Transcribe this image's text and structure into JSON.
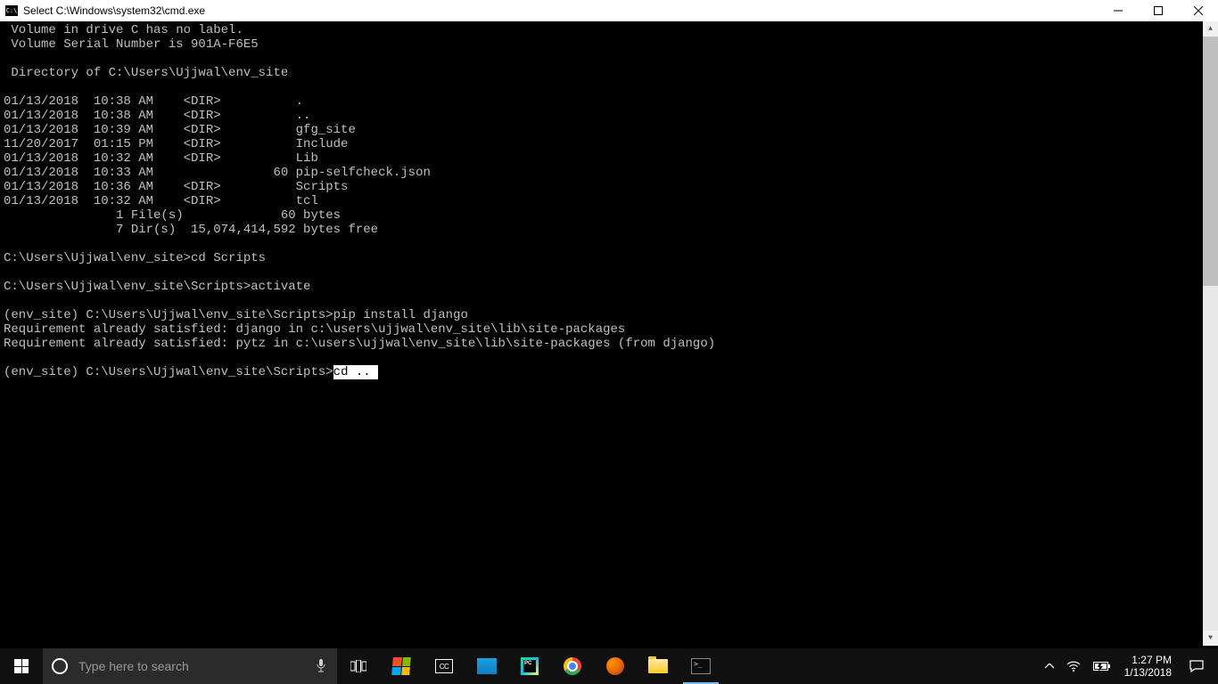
{
  "window": {
    "title": "Select C:\\Windows\\system32\\cmd.exe",
    "app_icon_text": "C:\\"
  },
  "terminal_output": " Volume in drive C has no label.\n Volume Serial Number is 901A-F6E5\n\n Directory of C:\\Users\\Ujjwal\\env_site\n\n01/13/2018  10:38 AM    <DIR>          .\n01/13/2018  10:38 AM    <DIR>          ..\n01/13/2018  10:39 AM    <DIR>          gfg_site\n11/20/2017  01:15 PM    <DIR>          Include\n01/13/2018  10:32 AM    <DIR>          Lib\n01/13/2018  10:33 AM                60 pip-selfcheck.json\n01/13/2018  10:36 AM    <DIR>          Scripts\n01/13/2018  10:32 AM    <DIR>          tcl\n               1 File(s)             60 bytes\n               7 Dir(s)  15,074,414,592 bytes free\n\nC:\\Users\\Ujjwal\\env_site>cd Scripts\n\nC:\\Users\\Ujjwal\\env_site\\Scripts>activate\n\n(env_site) C:\\Users\\Ujjwal\\env_site\\Scripts>pip install django\nRequirement already satisfied: django in c:\\users\\ujjwal\\env_site\\lib\\site-packages\nRequirement already satisfied: pytz in c:\\users\\ujjwal\\env_site\\lib\\site-packages (from django)\n",
  "prompt_line_prefix": "(env_site) C:\\Users\\Ujjwal\\env_site\\Scripts>",
  "selected_command": "cd .. ",
  "taskbar": {
    "search_placeholder": "Type here to search",
    "time": "1:27 PM",
    "date": "1/13/2018",
    "cc_label": "CC",
    "pycharm_label": "PC"
  }
}
